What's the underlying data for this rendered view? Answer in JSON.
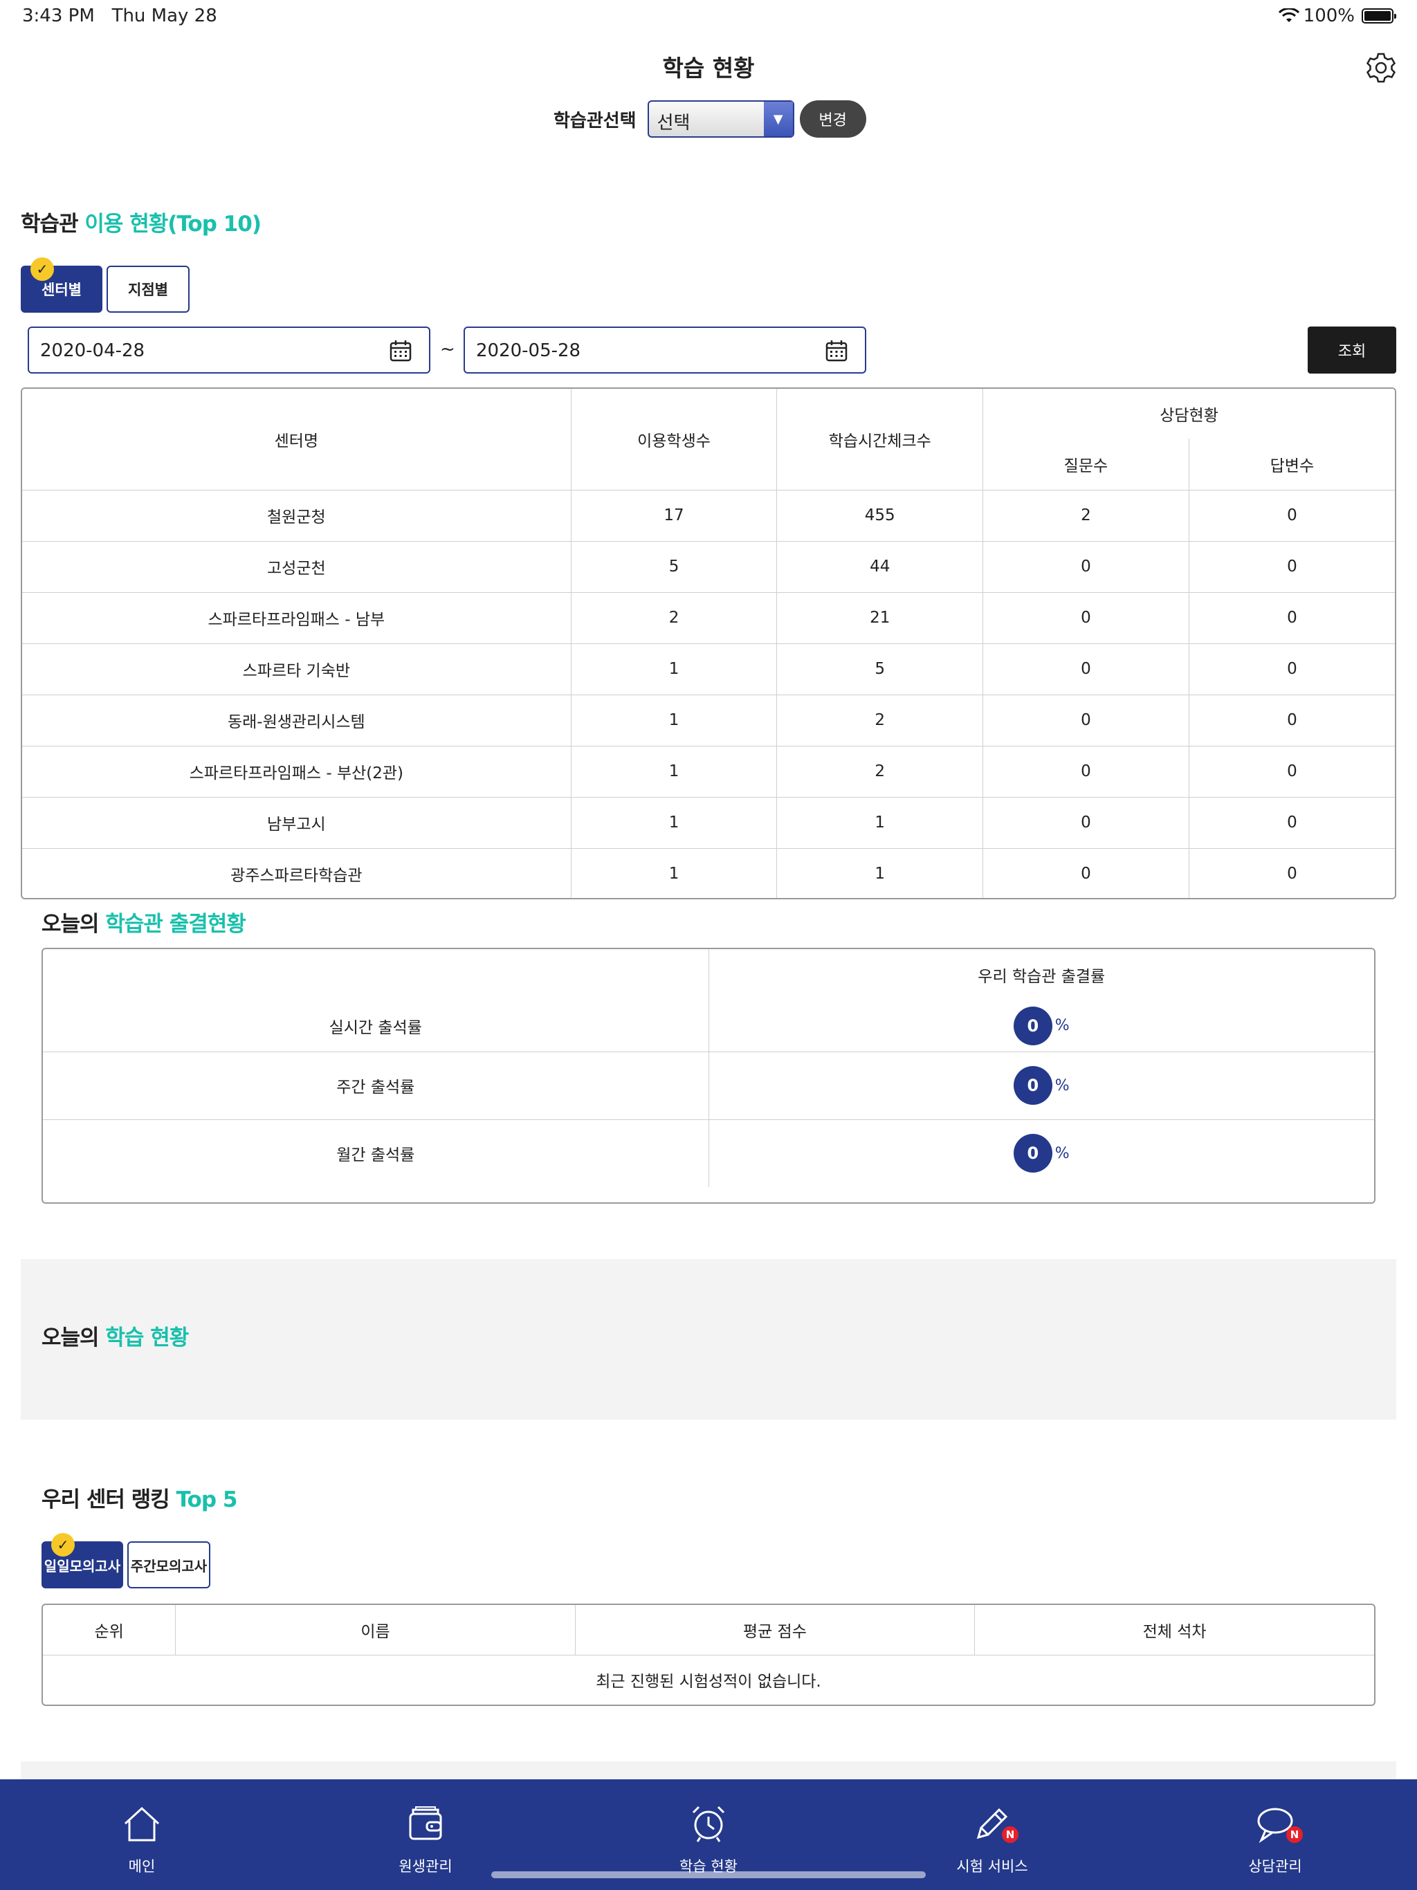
{
  "status": {
    "time": "3:43 PM",
    "date": "Thu May 28",
    "battery": "100%"
  },
  "header": {
    "title": "학습 현황"
  },
  "selector": {
    "label": "학습관선택",
    "value": "선택",
    "change_label": "변경"
  },
  "usage": {
    "title_prefix": "학습관",
    "title_accent": "이용 현황(Top 10)",
    "tabs": [
      "센터별",
      "지점별"
    ],
    "date_from": "2020-04-28",
    "date_to": "2020-05-28",
    "tilde": "~",
    "search_label": "조회",
    "headers": {
      "center": "센터명",
      "students": "이용학생수",
      "checks": "학습시간체크수",
      "consult": "상담현황",
      "questions": "질문수",
      "answers": "답변수"
    },
    "rows": [
      {
        "name": "철원군청",
        "students": "17",
        "checks": "455",
        "questions": "2",
        "answers": "0"
      },
      {
        "name": "고성군천",
        "students": "5",
        "checks": "44",
        "questions": "0",
        "answers": "0"
      },
      {
        "name": "스파르타프라임패스 - 남부",
        "students": "2",
        "checks": "21",
        "questions": "0",
        "answers": "0"
      },
      {
        "name": "스파르타 기숙반",
        "students": "1",
        "checks": "5",
        "questions": "0",
        "answers": "0"
      },
      {
        "name": "동래-원생관리시스템",
        "students": "1",
        "checks": "2",
        "questions": "0",
        "answers": "0"
      },
      {
        "name": "스파르타프라임패스 - 부산(2관)",
        "students": "1",
        "checks": "2",
        "questions": "0",
        "answers": "0"
      },
      {
        "name": "남부고시",
        "students": "1",
        "checks": "1",
        "questions": "0",
        "answers": "0"
      },
      {
        "name": "광주스파르타학습관",
        "students": "1",
        "checks": "1",
        "questions": "0",
        "answers": "0"
      }
    ]
  },
  "attendance": {
    "title_prefix": "오늘의",
    "title_accent": "학습관 출결현황",
    "column_header": "우리 학습관 출결률",
    "unit": "%",
    "rows": [
      {
        "label": "실시간 출석률",
        "value": "0"
      },
      {
        "label": "주간 출석률",
        "value": "0"
      },
      {
        "label": "월간 출석률",
        "value": "0"
      }
    ]
  },
  "study": {
    "title_prefix": "오늘의",
    "title_accent": "학습 현황"
  },
  "ranking": {
    "title_prefix": "우리 센터 랭킹",
    "title_accent": "Top 5",
    "tabs": [
      "일일모의고사",
      "주간모의고사"
    ],
    "headers": {
      "rank": "순위",
      "name": "이름",
      "avg": "평균 점수",
      "overall": "전체 석차"
    },
    "empty_message": "최근 진행된 시험성적이 없습니다."
  },
  "nav": {
    "items": [
      {
        "label": "메인",
        "icon": "home-icon"
      },
      {
        "label": "원생관리",
        "icon": "wallet-icon"
      },
      {
        "label": "학습 현황",
        "icon": "alarm-clock-icon"
      },
      {
        "label": "시험 서비스",
        "icon": "pencil-icon",
        "badge": "N"
      },
      {
        "label": "상담관리",
        "icon": "chat-bubble-icon",
        "badge": "N"
      }
    ]
  },
  "colors": {
    "primary": "#24398b",
    "accent": "#19c0ac",
    "badge": "#f6c928",
    "alert": "#e6202a"
  }
}
